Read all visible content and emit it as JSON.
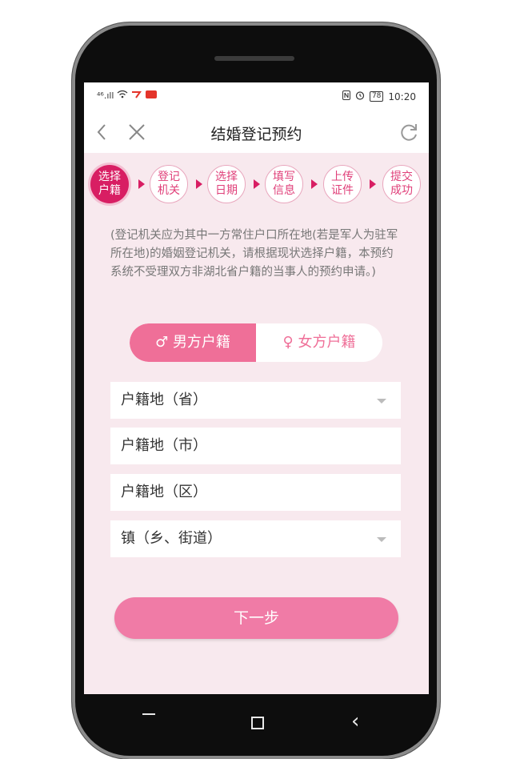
{
  "status_bar": {
    "signal": "⁴⁶.ıll",
    "right": {
      "battery": "78",
      "time": "10:20"
    }
  },
  "header": {
    "title": "结婚登记预约",
    "back_icon": "chevron-left-icon",
    "close_icon": "close-icon",
    "refresh_icon": "refresh-icon"
  },
  "steps": [
    {
      "label": "选择户籍",
      "active": true
    },
    {
      "label": "登记机关",
      "active": false
    },
    {
      "label": "选择日期",
      "active": false
    },
    {
      "label": "填写信息",
      "active": false
    },
    {
      "label": "上传证件",
      "active": false
    },
    {
      "label": "提交成功",
      "active": false
    }
  ],
  "note": "(登记机关应为其中一方常住户口所在地(若是军人为驻军所在地)的婚姻登记机关，请根据现状选择户籍，本预约系统不受理双方非湖北省户籍的当事人的预约申请。)",
  "gender_toggle": {
    "male": {
      "symbol": "♂",
      "label": "男方户籍",
      "selected": true
    },
    "female": {
      "symbol": "♀",
      "label": "女方户籍",
      "selected": false
    }
  },
  "fields": {
    "province": "户籍地（省）",
    "city": "户籍地（市）",
    "district": "户籍地（区）",
    "town": "镇（乡、街道）"
  },
  "next_button": "下一步",
  "softkeys": {
    "back": "‹"
  },
  "colors": {
    "accent": "#d81e63",
    "pink": "#ef6f98",
    "background": "#f8e9ee"
  }
}
